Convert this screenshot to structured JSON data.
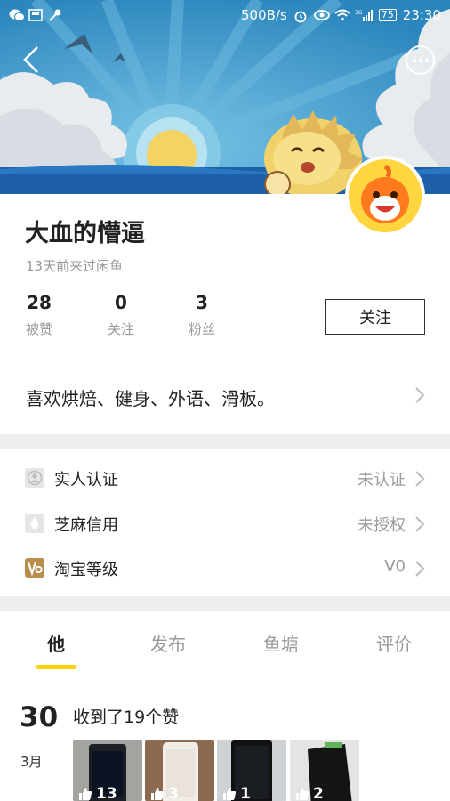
{
  "status_bar": {
    "network_speed": "500B/s",
    "battery": "75",
    "time": "23:30",
    "network_type": "3G"
  },
  "nav": {
    "back_icon": "chevron-left-icon",
    "more_icon": "more-dots-icon"
  },
  "profile": {
    "name": "大血的懵逼",
    "last_seen": "13天前来过闲鱼",
    "stats": [
      {
        "value": "28",
        "label": "被赞"
      },
      {
        "value": "0",
        "label": "关注"
      },
      {
        "value": "3",
        "label": "粉丝"
      }
    ],
    "follow_button": "关注",
    "bio": "喜欢烘焙、健身、外语、滑板。"
  },
  "verifications": [
    {
      "label": "实人认证",
      "value": "未认证",
      "icon": "person-id-icon"
    },
    {
      "label": "芝麻信用",
      "value": "未授权",
      "icon": "sesame-credit-icon"
    },
    {
      "label": "淘宝等级",
      "value": "V0",
      "icon": "taobao-level-icon"
    }
  ],
  "tabs": [
    "他",
    "发布",
    "鱼塘",
    "评价"
  ],
  "active_tab": "他",
  "feed": {
    "day": "30",
    "month": "3月",
    "title": "收到了19个赞",
    "thumbnails": [
      {
        "likes": "13"
      },
      {
        "likes": "3"
      },
      {
        "likes": "1"
      },
      {
        "likes": "2"
      }
    ]
  },
  "colors": {
    "accent": "#ffd300",
    "banner_sky": "#2f93c9",
    "divider": "#ededed"
  }
}
